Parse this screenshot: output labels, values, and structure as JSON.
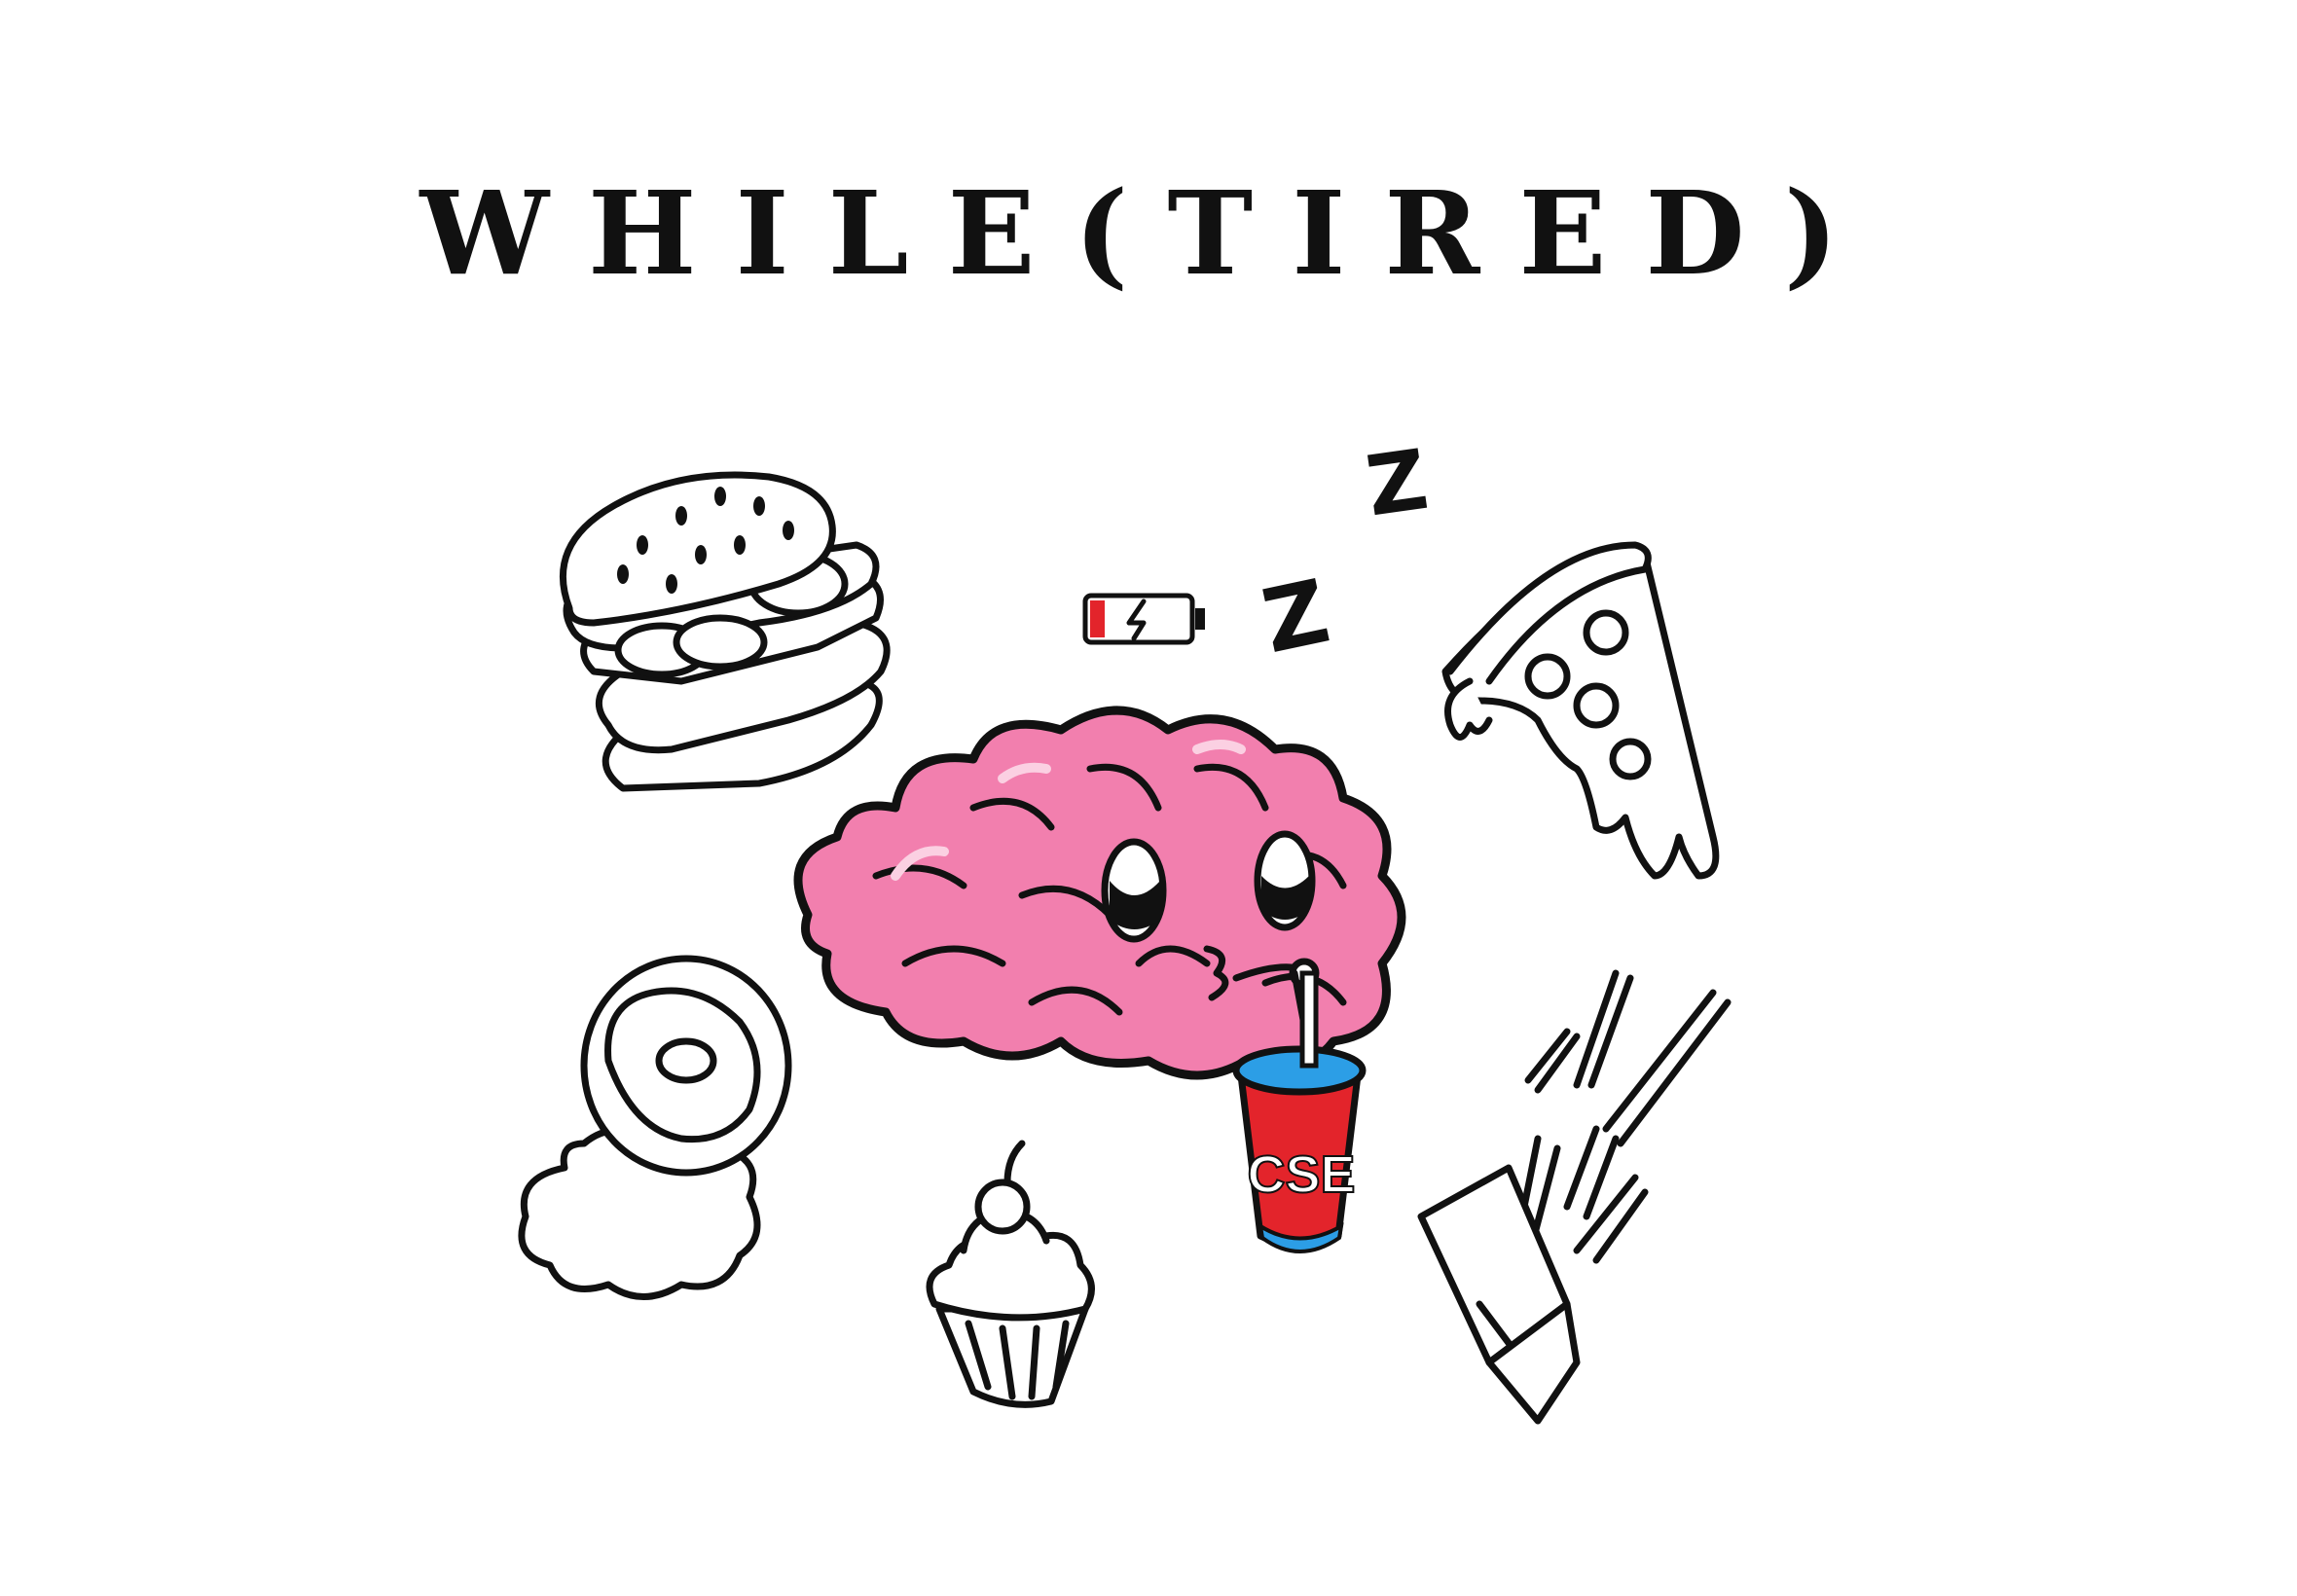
{
  "title": "WHILE(TIRED)",
  "cup_label": "CSE",
  "sleep_letters": [
    "Z",
    "Z"
  ],
  "battery_level": 0.15,
  "colors": {
    "brain": "#f27fae",
    "brain_highlight": "#fbd0e2",
    "cup": "#e3242b",
    "cup_lid": "#2c9ee6",
    "battery_low": "#e3242b",
    "ink": "#111111"
  },
  "icons": [
    "hamburger-icon",
    "pizza-slice-icon",
    "donut-icon",
    "cupcake-icon",
    "fries-icon",
    "battery-low-icon",
    "brain-icon",
    "soda-cup-icon"
  ]
}
